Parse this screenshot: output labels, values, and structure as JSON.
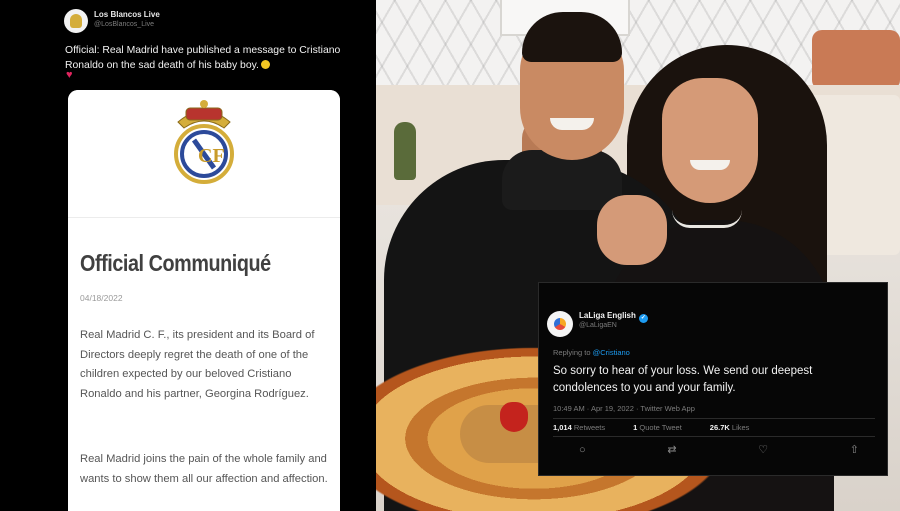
{
  "left_tweet": {
    "account_name": "Los Blancos Live",
    "account_handle": "@LosBlancos_Live",
    "text": "Official: Real Madrid have published a message to Cristiano Ronaldo on the sad death of his baby boy.",
    "card": {
      "title": "Official Communiqué",
      "date": "04/18/2022",
      "paragraph1": "Real Madrid C. F., its president and its Board of Directors deeply regret the death of one of the children expected by our beloved Cristiano Ronaldo and his partner, Georgina Rodríguez.",
      "paragraph2": "Real Madrid joins the pain of the whole family and wants to show them all our affection and affection."
    },
    "icons": [
      "emoji-icon",
      "heart-icon",
      "real-madrid-crest-icon"
    ]
  },
  "right_tweet": {
    "account_name": "LaLiga English",
    "account_handle": "@LaLigaEN",
    "replying_prefix": "Replying to",
    "replying_to": "@Cristiano",
    "text": "So sorry to hear of your loss. We send our deepest condolences to you and your family.",
    "meta": "10:49 AM · Apr 19, 2022 · Twitter Web App",
    "stats": {
      "retweets_count": "1,014",
      "retweets_label": "Retweets",
      "quotes_count": "1",
      "quotes_label": "Quote Tweet",
      "likes_count": "26.7K",
      "likes_label": "Likes"
    },
    "actions": {
      "reply": "○",
      "retweet": "⇄",
      "like": "♡",
      "share": "⇧"
    }
  },
  "colors": {
    "tweet_background": "#000000",
    "link_blue": "#1d9bf0",
    "heart_red": "#e0245e"
  }
}
